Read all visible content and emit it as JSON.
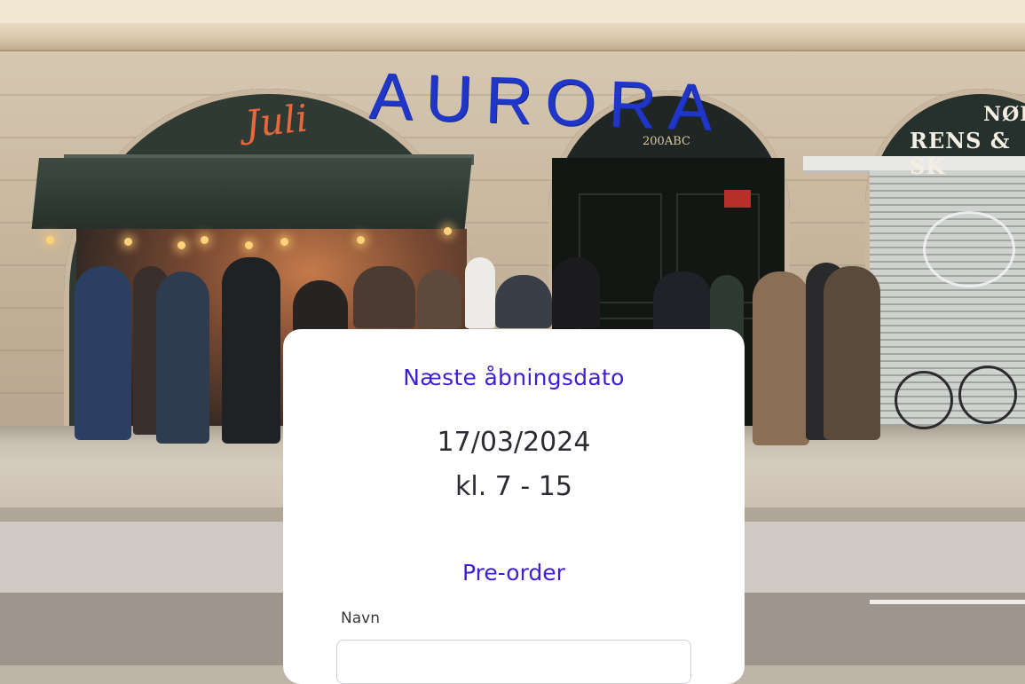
{
  "hero": {
    "brand": "AURORA",
    "neighbor_sign": "Juli",
    "door_sign": "200ABC",
    "right_sign_line1": "NØR",
    "right_sign_line2": "RENS & SK"
  },
  "opening": {
    "label": "Næste åbningsdato",
    "date": "17/03/2024",
    "hours": "kl. 7 - 15"
  },
  "preorder": {
    "title": "Pre-order",
    "name_label": "Navn",
    "name_value": "",
    "name_placeholder": ""
  },
  "colors": {
    "accent": "#3b1fd6",
    "brand_blue": "#1f36c8",
    "card_bg": "#ffffff",
    "text_dark": "#2b2b33"
  }
}
